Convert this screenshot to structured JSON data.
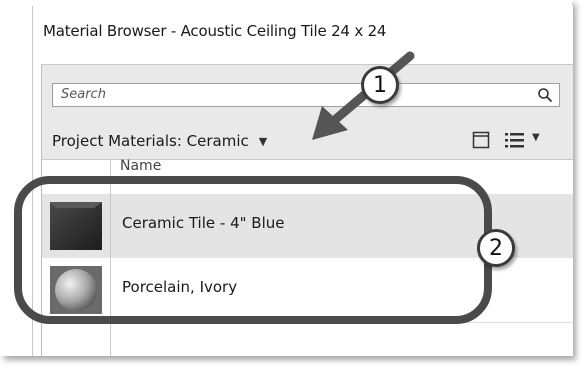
{
  "window": {
    "title": "Material Browser - Acoustic Ceiling Tile 24 x 24"
  },
  "search": {
    "placeholder": "Search",
    "icon": "search-icon"
  },
  "toolbar": {
    "library_label": "Project Materials: Ceramic",
    "view_icon": "panel-view-icon",
    "list_icon": "list-view-icon"
  },
  "list": {
    "column_header": "Name",
    "items": [
      {
        "label": "Ceramic Tile - 4\" Blue",
        "icon": "dark-cube-thumbnail",
        "selected": true
      },
      {
        "label": "Porcelain, Ivory",
        "icon": "sphere-thumbnail",
        "selected": false
      }
    ]
  },
  "callouts": {
    "one": "1",
    "two": "2"
  },
  "colors": {
    "panel_bg": "#e9e9e9",
    "selected_row": "#e4e4e4",
    "callout_border": "#3a3a3a"
  }
}
